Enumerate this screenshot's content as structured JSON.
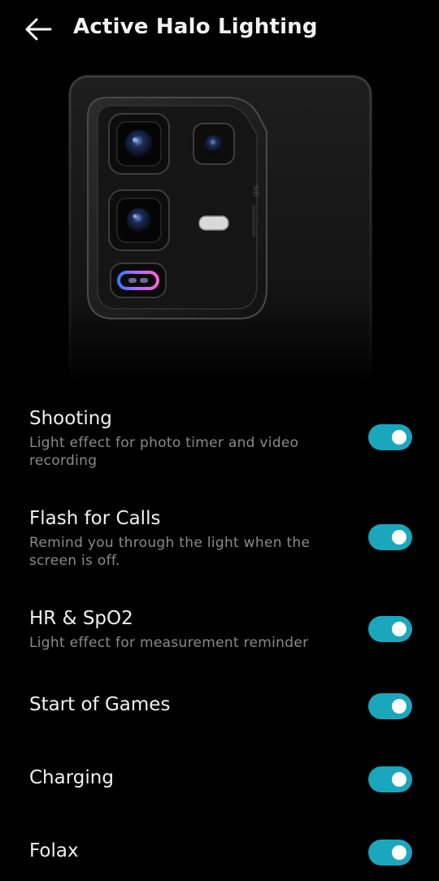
{
  "header": {
    "title": "Active Halo Lighting",
    "back_icon": "arrow-left-icon"
  },
  "hero": {
    "image": "phone-camera-module-image",
    "side_label": "SIO"
  },
  "settings": [
    {
      "id": "shooting",
      "title": "Shooting",
      "description": "Light effect for photo timer and video recording",
      "enabled": true
    },
    {
      "id": "flash-for-calls",
      "title": "Flash for Calls",
      "description": "Remind you through the light when the screen is off.",
      "enabled": true
    },
    {
      "id": "hr-spo2",
      "title": "HR & SpO2",
      "description": "Light effect for measurement reminder",
      "enabled": true
    },
    {
      "id": "start-of-games",
      "title": "Start of Games",
      "description": "",
      "enabled": true
    },
    {
      "id": "charging",
      "title": "Charging",
      "description": "",
      "enabled": true
    },
    {
      "id": "folax",
      "title": "Folax",
      "description": "",
      "enabled": true
    }
  ],
  "colors": {
    "background": "#000000",
    "accent": "#1aa6bd",
    "primary_text": "#f0f0f0",
    "secondary_text": "#8a8a8a"
  }
}
